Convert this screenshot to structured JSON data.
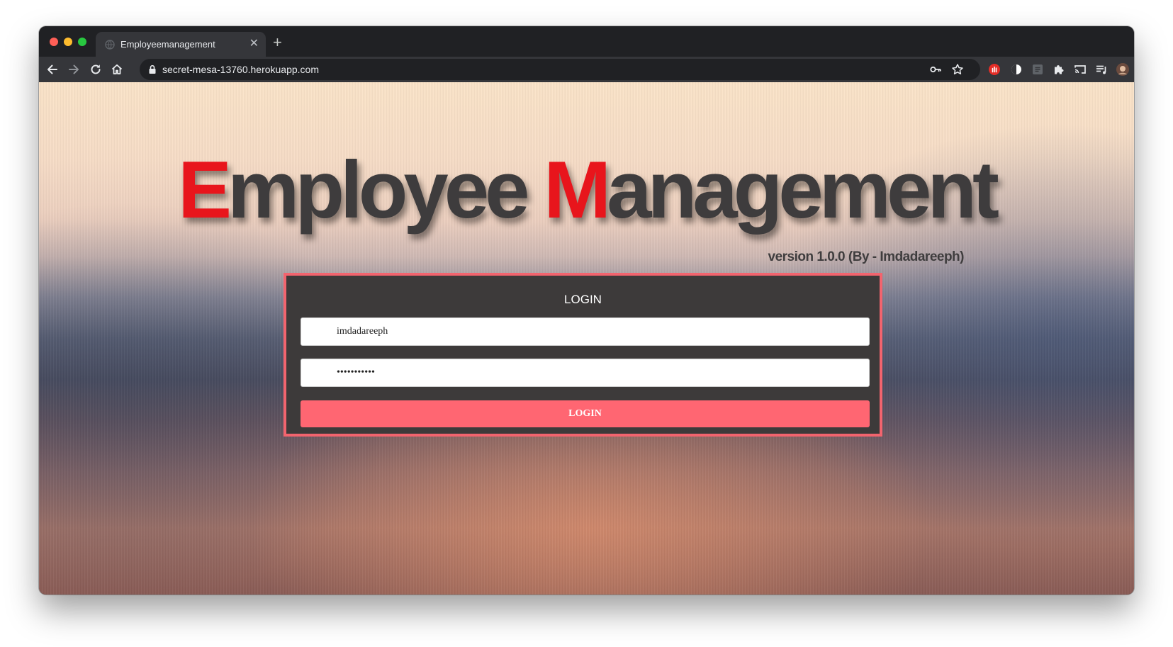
{
  "browser": {
    "tab_title": "Employeemanagement",
    "url": "secret-mesa-13760.herokuapp.com",
    "icons": [
      "back-icon",
      "forward-icon",
      "reload-icon",
      "home-icon",
      "lock-icon",
      "key-icon",
      "star-icon",
      "extension-icons",
      "puzzle-icon",
      "cast-icon",
      "media-icon",
      "profile-avatar",
      "menu-icon"
    ]
  },
  "hero": {
    "cap1": "E",
    "rest1": "mployee ",
    "cap2": "M",
    "rest2": "anagement",
    "version": "version 1.0.0 (By - Imdadareeph)",
    "accent_color": "#e8151c",
    "text_color": "#3e3c3d"
  },
  "login": {
    "heading": "LOGIN",
    "username_value": "imdadareeph",
    "password_value": "•••••••••••",
    "button_label": "LOGIN",
    "border_color": "#f2646e",
    "button_color": "#ff6672"
  }
}
